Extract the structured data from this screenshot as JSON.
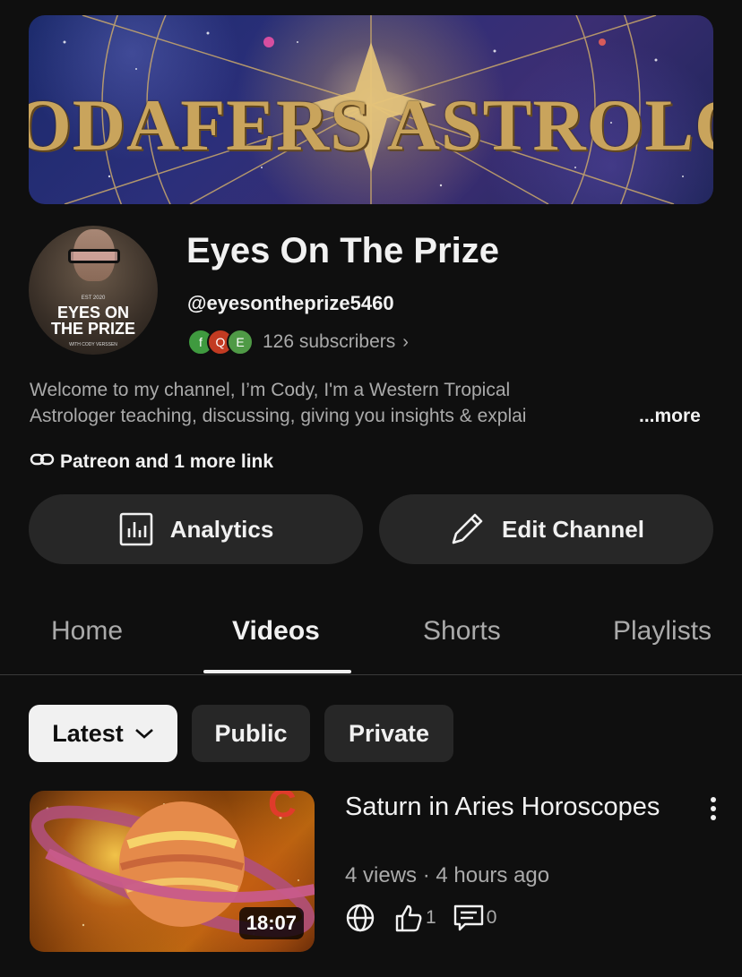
{
  "banner": {
    "text": "ODAFERS ASTROLOG"
  },
  "avatar": {
    "est": "EST 2020",
    "line1": "EYES ON",
    "line2": "THE PRIZE",
    "with": "WITH CODY VERSSEN"
  },
  "channel": {
    "title": "Eyes On The Prize",
    "handle": "@eyesontheprize5460",
    "subscriber_avatars": [
      {
        "letter": "f",
        "color": "#3f9a3f"
      },
      {
        "letter": "Q",
        "color": "#c23b22"
      },
      {
        "letter": "E",
        "color": "#4f9a46"
      }
    ],
    "subscribers": "126 subscribers",
    "subscribers_chevron": "›",
    "description_line1": "Welcome to my channel, I’m Cody, I'm a Western Tropical",
    "description_line2": "Astrologer teaching, discussing, giving you insights & explai",
    "more": "...more",
    "links": "Patreon and 1 more link"
  },
  "buttons": {
    "analytics": "Analytics",
    "edit_channel": "Edit Channel"
  },
  "tabs": {
    "home": "Home",
    "videos": "Videos",
    "shorts": "Shorts",
    "playlists": "Playlists",
    "active": "Videos"
  },
  "filters": {
    "latest": "Latest",
    "public": "Public",
    "private": "Private"
  },
  "video": {
    "title": "Saturn in Aries Horoscopes",
    "meta": "4 views · 4 hours ago",
    "duration": "18:07",
    "likes": "1",
    "comments": "0",
    "thumb_badge": "C"
  },
  "icons": {
    "link": "link-icon",
    "analytics": "bar-chart-icon",
    "edit": "pencil-icon",
    "chevron": "chevron-down-icon",
    "visibility": "globe-icon",
    "like": "thumbs-up-icon",
    "comment": "comment-icon",
    "menu": "more-vertical-icon"
  }
}
